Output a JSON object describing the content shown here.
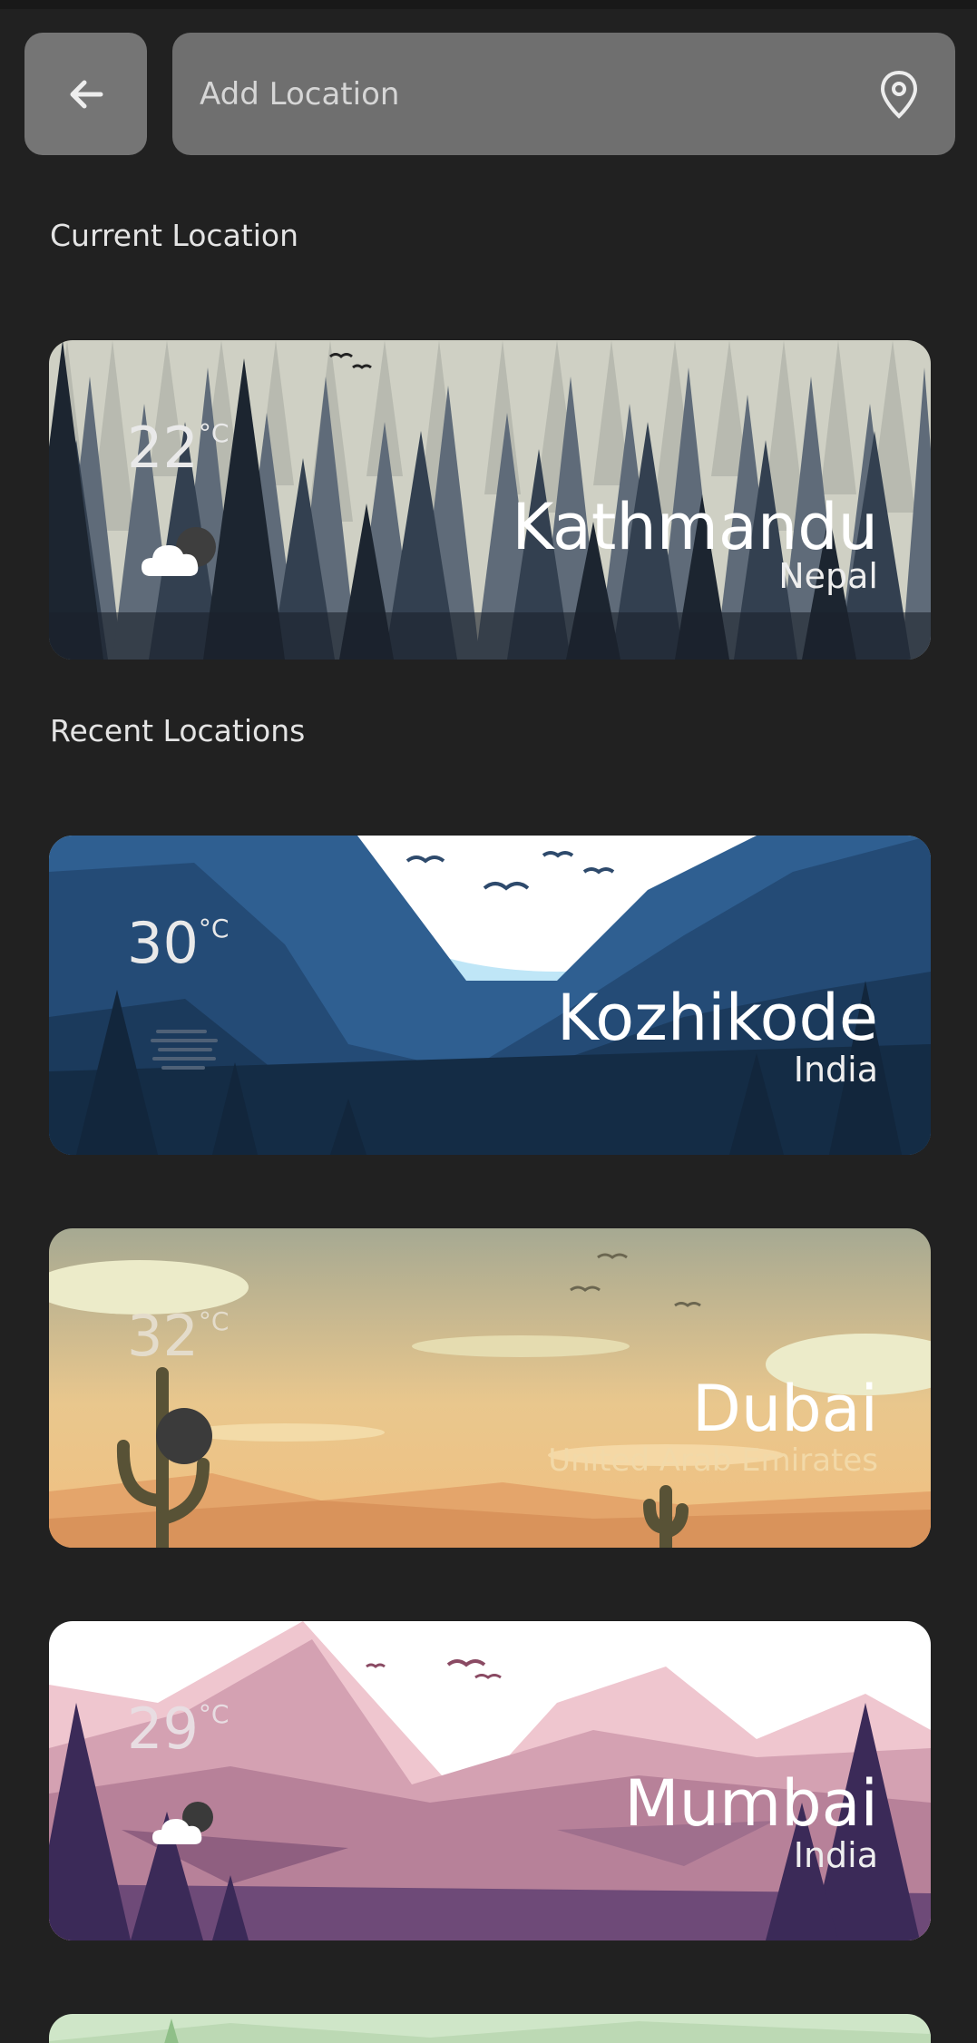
{
  "search": {
    "placeholder": "Add Location"
  },
  "sections": {
    "current_title": "Current Location",
    "recent_title": "Recent Locations"
  },
  "current_location": {
    "temp": "22",
    "unit": "°C",
    "weather_icon": "cloudy-night-icon",
    "city": "Kathmandu",
    "country": "Nepal"
  },
  "recent_locations": [
    {
      "temp": "30",
      "unit": "°C",
      "weather_icon": "haze-icon",
      "city": "Kozhikode",
      "country": "India"
    },
    {
      "temp": "32",
      "unit": "°C",
      "weather_icon": "moon-icon",
      "city": "Dubai",
      "country": "United Arab Emirates"
    },
    {
      "temp": "29",
      "unit": "°C",
      "weather_icon": "cloudy-night-icon",
      "city": "Mumbai",
      "country": "India"
    }
  ],
  "colors": {
    "background": "#212121",
    "button": "#757575",
    "search_bar": "#6f6f6f"
  }
}
